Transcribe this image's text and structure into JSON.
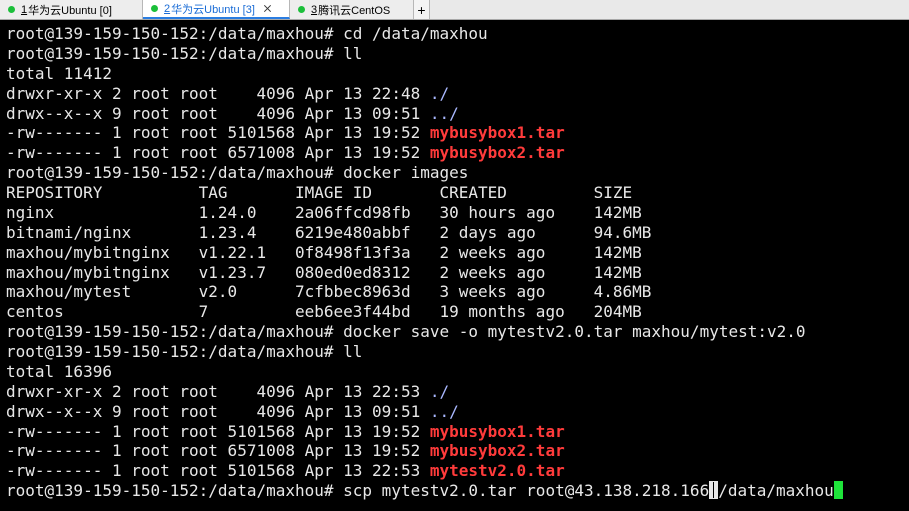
{
  "tabs": [
    {
      "index": "1",
      "name": "华为云Ubuntu [0]",
      "active": false
    },
    {
      "index": "2",
      "name": "华为云Ubuntu [3]",
      "active": true
    },
    {
      "index": "3",
      "name": "腾讯云CentOS",
      "active": false
    }
  ],
  "add_tab_label": "+",
  "colors": {
    "background": "#000000",
    "text": "#e8e8e8",
    "archive_highlight": "#ff3b3b",
    "dir_link": "#a9b8ff",
    "cursor": "#1ee33a",
    "tab_active_accent": "#2a7de1",
    "status_dot": "#1bbf3a"
  },
  "terminal": {
    "lines": [
      {
        "segments": [
          {
            "text": "root@139-159-150-152:/data/maxhou# cd /data/maxhou"
          }
        ]
      },
      {
        "segments": [
          {
            "text": "root@139-159-150-152:/data/maxhou# ll"
          }
        ]
      },
      {
        "segments": [
          {
            "text": "total 11412"
          }
        ]
      },
      {
        "segments": [
          {
            "text": "drwxr-xr-x 2 root root    4096 Apr 13 22:48 "
          },
          {
            "text": "./",
            "style": "blue"
          }
        ]
      },
      {
        "segments": [
          {
            "text": "drwx--x--x 9 root root    4096 Apr 13 09:51 "
          },
          {
            "text": "../",
            "style": "blue"
          }
        ]
      },
      {
        "segments": [
          {
            "text": "-rw------- 1 root root 5101568 Apr 13 19:52 "
          },
          {
            "text": "mybusybox1.tar",
            "style": "red"
          }
        ]
      },
      {
        "segments": [
          {
            "text": "-rw------- 1 root root 6571008 Apr 13 19:52 "
          },
          {
            "text": "mybusybox2.tar",
            "style": "red"
          }
        ]
      },
      {
        "segments": [
          {
            "text": "root@139-159-150-152:/data/maxhou# docker images"
          }
        ]
      },
      {
        "segments": [
          {
            "text": "REPOSITORY          TAG       IMAGE ID       CREATED         SIZE"
          }
        ]
      },
      {
        "segments": [
          {
            "text": "nginx               1.24.0    2a06ffcd98fb   30 hours ago    142MB"
          }
        ]
      },
      {
        "segments": [
          {
            "text": "bitnami/nginx       1.23.4    6219e480abbf   2 days ago      94.6MB"
          }
        ]
      },
      {
        "segments": [
          {
            "text": "maxhou/mybitnginx   v1.22.1   0f8498f13f3a   2 weeks ago     142MB"
          }
        ]
      },
      {
        "segments": [
          {
            "text": "maxhou/mybitnginx   v1.23.7   080ed0ed8312   2 weeks ago     142MB"
          }
        ]
      },
      {
        "segments": [
          {
            "text": "maxhou/mytest       v2.0      7cfbbec8963d   3 weeks ago     4.86MB"
          }
        ]
      },
      {
        "segments": [
          {
            "text": "centos              7         eeb6ee3f44bd   19 months ago   204MB"
          }
        ]
      },
      {
        "segments": [
          {
            "text": "root@139-159-150-152:/data/maxhou# docker save -o mytestv2.0.tar maxhou/mytest:v2.0"
          }
        ]
      },
      {
        "segments": [
          {
            "text": "root@139-159-150-152:/data/maxhou# ll"
          }
        ]
      },
      {
        "segments": [
          {
            "text": "total 16396"
          }
        ]
      },
      {
        "segments": [
          {
            "text": "drwxr-xr-x 2 root root    4096 Apr 13 22:53 "
          },
          {
            "text": "./",
            "style": "blue"
          }
        ]
      },
      {
        "segments": [
          {
            "text": "drwx--x--x 9 root root    4096 Apr 13 09:51 "
          },
          {
            "text": "../",
            "style": "blue"
          }
        ]
      },
      {
        "segments": [
          {
            "text": "-rw------- 1 root root 5101568 Apr 13 19:52 "
          },
          {
            "text": "mybusybox1.tar",
            "style": "red"
          }
        ]
      },
      {
        "segments": [
          {
            "text": "-rw------- 1 root root 6571008 Apr 13 19:52 "
          },
          {
            "text": "mybusybox2.tar",
            "style": "red"
          }
        ]
      },
      {
        "segments": [
          {
            "text": "-rw------- 1 root root 5101568 Apr 13 22:53 "
          },
          {
            "text": "mytestv2.0.tar",
            "style": "red"
          }
        ]
      }
    ],
    "current_command": {
      "before_ibeam": "root@139-159-150-152:/data/maxhou# scp mytestv2.0.tar root@43.138.218.166",
      "under_ibeam": ":",
      "after_ibeam": "/data/maxhou"
    }
  }
}
